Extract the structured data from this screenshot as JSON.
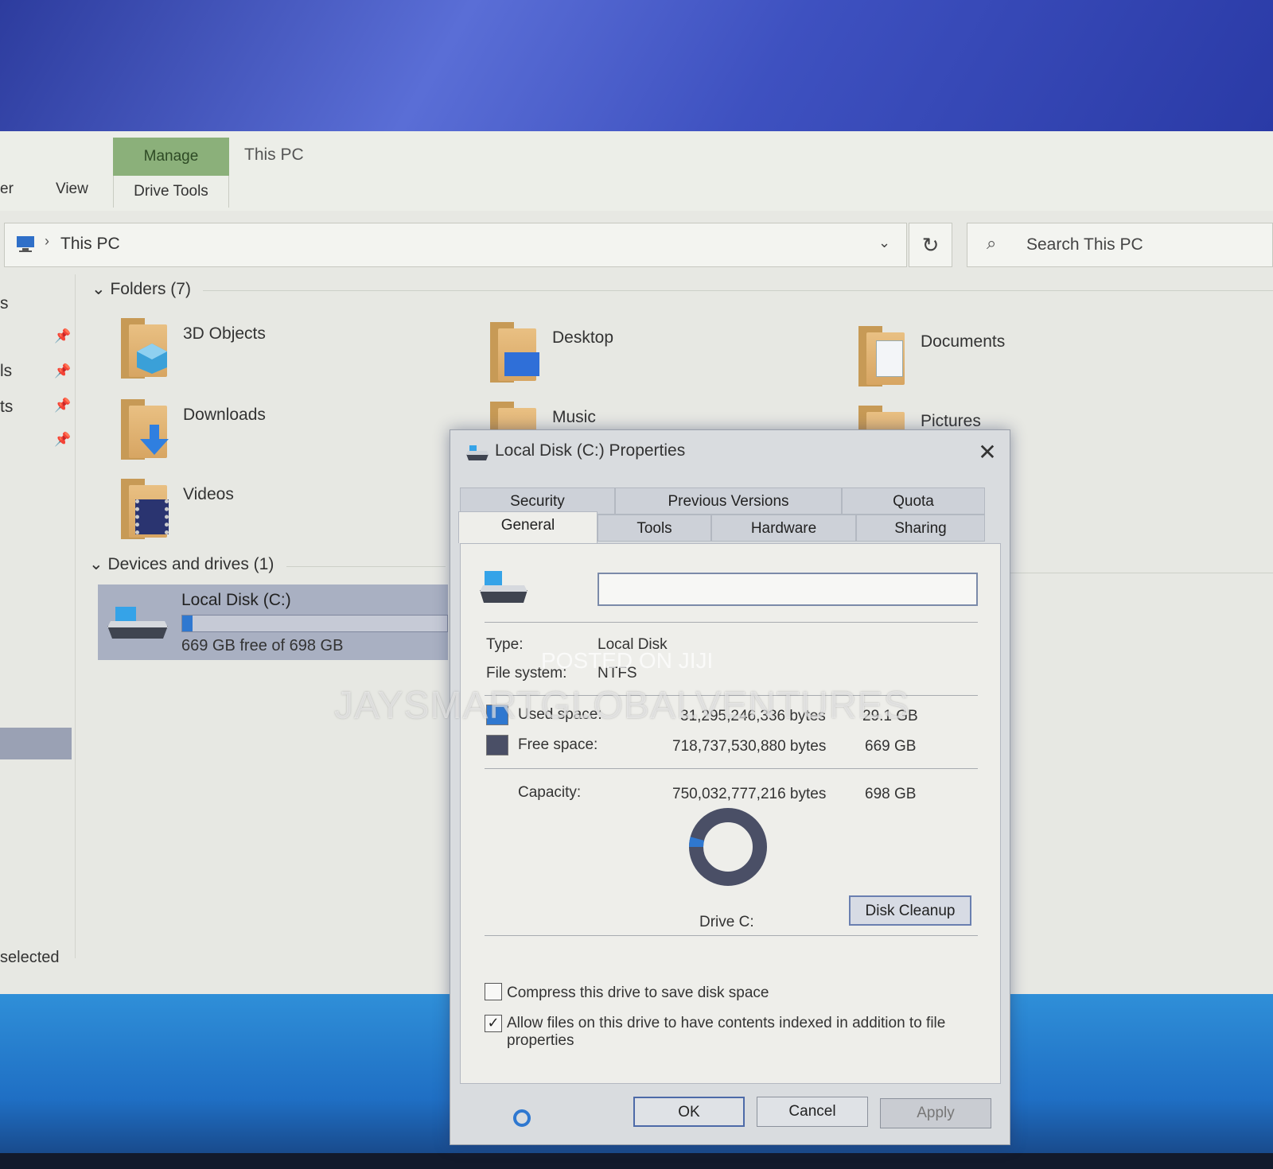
{
  "ribbon": {
    "tab_partial": "er",
    "view_tab": "View",
    "manage_tab": "Manage",
    "drive_tools_tab": "Drive Tools",
    "context_title": "This PC"
  },
  "address": {
    "path": "This PC",
    "search_placeholder": "Search This PC"
  },
  "nav": {
    "fragments": [
      "s",
      "ls",
      "ts"
    ]
  },
  "folders": {
    "header": "Folders (7)",
    "items": [
      "3D Objects",
      "Desktop",
      "Documents",
      "Downloads",
      "Music",
      "Pictures",
      "Videos"
    ]
  },
  "devices": {
    "header": "Devices and drives (1)",
    "drive_name": "Local Disk (C:)",
    "drive_free_text": "669 GB free of 698 GB",
    "used_fraction": 0.04
  },
  "status": {
    "text": "selected"
  },
  "dialog": {
    "title": "Local Disk (C:) Properties",
    "tabs_top": [
      "Security",
      "Previous Versions",
      "Quota"
    ],
    "tabs_bottom": [
      "General",
      "Tools",
      "Hardware",
      "Sharing"
    ],
    "label_value": "",
    "type_label": "Type:",
    "type_value": "Local Disk",
    "fs_label": "File system:",
    "fs_value": "NTFS",
    "used_label": "Used space:",
    "used_bytes": "31,295,246,336 bytes",
    "used_gb": "29.1 GB",
    "free_label": "Free space:",
    "free_bytes": "718,737,530,880 bytes",
    "free_gb": "669 GB",
    "capacity_label": "Capacity:",
    "capacity_bytes": "750,032,777,216 bytes",
    "capacity_gb": "698 GB",
    "drive_label": "Drive C:",
    "disk_cleanup": "Disk Cleanup",
    "compress_label": "Compress this drive to save disk space",
    "compress_checked": false,
    "index_label_1": "Allow files on this drive to have contents indexed in addition to file",
    "index_label_2": "properties",
    "index_checked": true,
    "ok": "OK",
    "cancel": "Cancel",
    "apply": "Apply",
    "used_fraction": 0.042
  },
  "watermarks": {
    "main": "JAYSMARTGLOBALVENTURES",
    "posted": "POSTED ON JIJI"
  },
  "colors": {
    "used": "#2f78d0",
    "free": "#4a4f66",
    "manage_tab": "#8bb07a"
  },
  "icons": {
    "pin": "pin-icon",
    "close": "close-icon",
    "search": "search-icon",
    "refresh": "refresh-icon"
  }
}
